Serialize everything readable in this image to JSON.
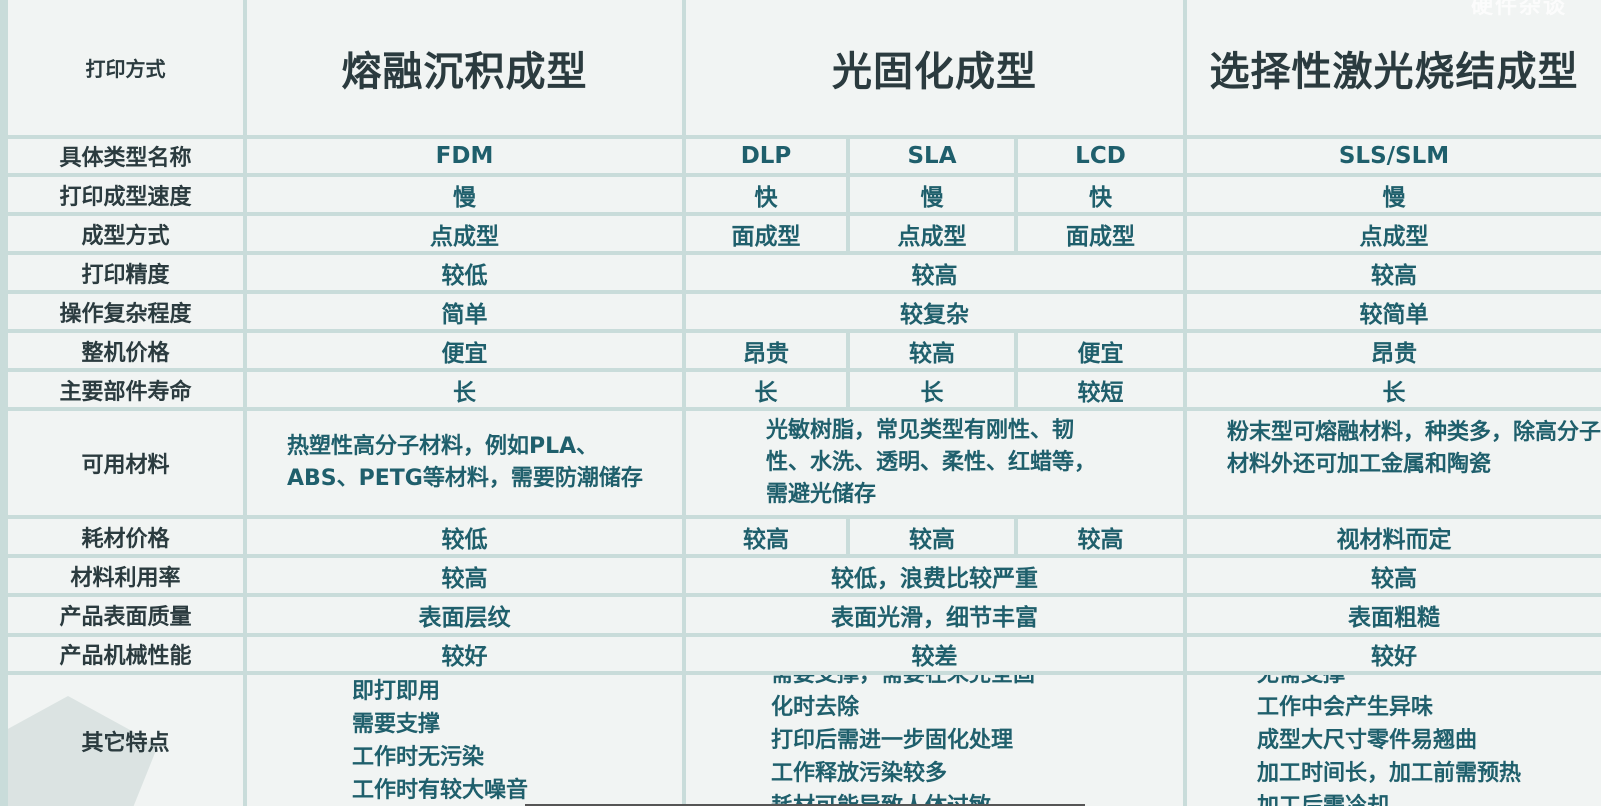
{
  "header": {
    "label": "打印方式",
    "fdm_group": "熔融沉积成型",
    "photo_group": "光固化成型",
    "sls_group": "选择性激光烧结成型"
  },
  "watermark": "硬件杂谈",
  "rows": {
    "type_name": {
      "label": "具体类型名称",
      "fdm": "FDM",
      "dlp": "DLP",
      "sla": "SLA",
      "lcd": "LCD",
      "sls": "SLS/SLM"
    },
    "speed": {
      "label": "打印成型速度",
      "fdm": "慢",
      "dlp": "快",
      "sla": "慢",
      "lcd": "快",
      "sls": "慢"
    },
    "method": {
      "label": "成型方式",
      "fdm": "点成型",
      "dlp": "面成型",
      "sla": "点成型",
      "lcd": "面成型",
      "sls": "点成型"
    },
    "precision": {
      "label": "打印精度",
      "fdm": "较低",
      "photo": "较高",
      "sls": "较高"
    },
    "complexity": {
      "label": "操作复杂程度",
      "fdm": "简单",
      "photo": "较复杂",
      "sls": "较简单"
    },
    "price": {
      "label": "整机价格",
      "fdm": "便宜",
      "dlp": "昂贵",
      "sla": "较高",
      "lcd": "便宜",
      "sls": "昂贵"
    },
    "lifespan": {
      "label": "主要部件寿命",
      "fdm": "长",
      "dlp": "长",
      "sla": "长",
      "lcd": "较短",
      "sls": "长"
    },
    "materials": {
      "label": "可用材料",
      "fdm": "热塑性高分子材料，例如PLA、ABS、PETG等材料，需要防潮储存",
      "photo": "光敏树脂，常见类型有刚性、韧性、水洗、透明、柔性、红蜡等，需避光储存",
      "sls": "粉末型可熔融材料，种类多，除高分子材料外还可加工金属和陶瓷"
    },
    "material_price": {
      "label": "耗材价格",
      "fdm": "较低",
      "dlp": "较高",
      "sla": "较高",
      "lcd": "较高",
      "sls": "视材料而定"
    },
    "utilization": {
      "label": "材料利用率",
      "fdm": "较高",
      "photo": "较低，浪费比较严重",
      "sls": "较高"
    },
    "surface": {
      "label": "产品表面质量",
      "fdm": "表面层纹",
      "photo": "表面光滑，细节丰富",
      "sls": "表面粗糙"
    },
    "mechanical": {
      "label": "产品机械性能",
      "fdm": "较好",
      "photo": "较差",
      "sls": "较好"
    },
    "other": {
      "label": "其它特点",
      "fdm": [
        "即打即用",
        "需要支撑",
        "工作时无污染",
        "工作时有较大噪音"
      ],
      "photo": [
        "需要支撑，需要在未完全固",
        "化时去除",
        "打印后需进一步固化处理",
        "工作释放污染较多",
        "耗材可能导致人体过敏"
      ],
      "sls": [
        "无需支撑",
        "工作中会产生异味",
        "成型大尺寸零件易翘曲",
        "加工时间长，加工前需预热",
        "加工后需冷却"
      ]
    }
  }
}
